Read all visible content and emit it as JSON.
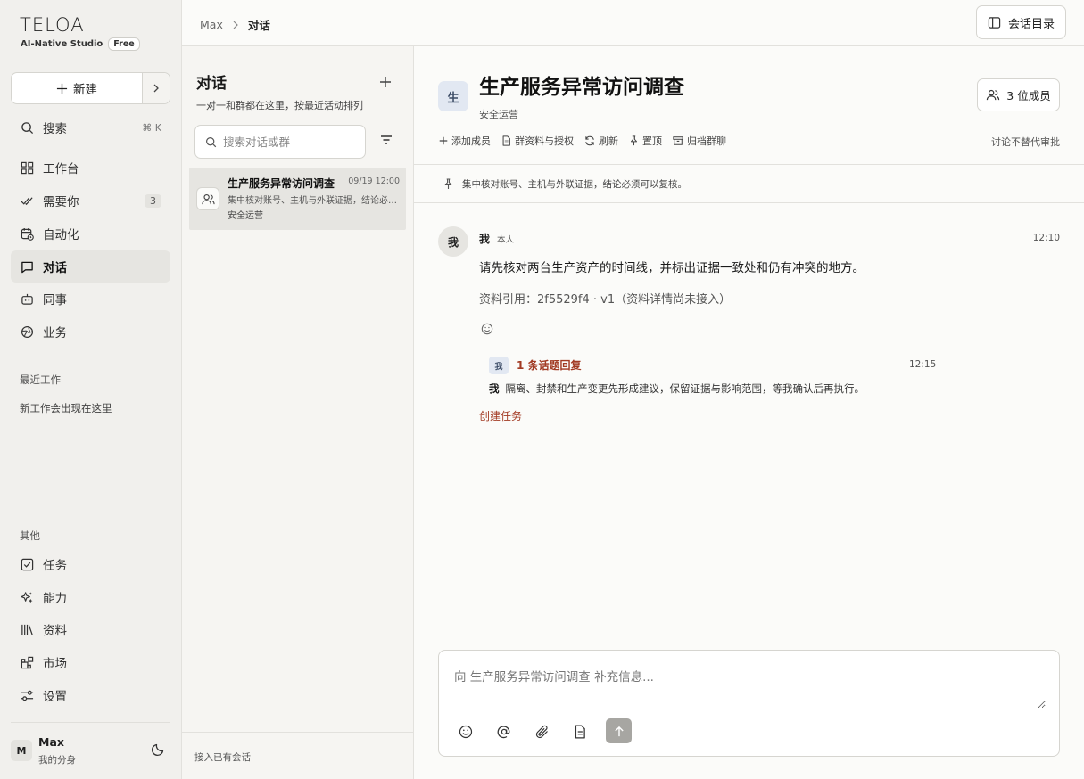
{
  "app": {
    "logo": "TELOA",
    "tagline": "AI-Native Studio",
    "plan_badge": "Free"
  },
  "sidebar": {
    "new_label": "新建",
    "search_label": "搜索",
    "search_shortcut": "⌘ K",
    "items": [
      {
        "label": "工作台",
        "icon": "grid-icon"
      },
      {
        "label": "需要你",
        "icon": "double-check-icon",
        "count": "3"
      },
      {
        "label": "自动化",
        "icon": "calendar-clock-icon"
      },
      {
        "label": "对话",
        "icon": "chat-icon",
        "active": true
      },
      {
        "label": "同事",
        "icon": "bot-icon"
      },
      {
        "label": "业务",
        "icon": "globe-icon"
      }
    ],
    "recent_label": "最近工作",
    "recent_empty": "新工作会出现在这里",
    "other_label": "其他",
    "other_items": [
      {
        "label": "任务",
        "icon": "checkbox-icon"
      },
      {
        "label": "能力",
        "icon": "sparkles-icon"
      },
      {
        "label": "资料",
        "icon": "library-icon"
      },
      {
        "label": "市场",
        "icon": "blocks-icon"
      },
      {
        "label": "设置",
        "icon": "sliders-icon"
      }
    ],
    "user": {
      "avatar": "M",
      "name": "Max",
      "subtitle": "我的分身"
    }
  },
  "topbar": {
    "breadcrumb": [
      "Max",
      "对话"
    ],
    "directory_label": "会话目录"
  },
  "conversations": {
    "title": "对话",
    "subtitle": "一对一和群都在这里，按最近活动排列",
    "search_placeholder": "搜索对话或群",
    "items": [
      {
        "name": "生产服务异常访问调查",
        "time": "09/19 12:00",
        "preview": "集中核对账号、主机与外联证据，结论必须可以复核。",
        "group": "安全运营"
      }
    ],
    "footer": "接入已有会话"
  },
  "chat": {
    "avatar": "生",
    "title": "生产服务异常访问调查",
    "subtitle": "安全运营",
    "members_label": "3 位成员",
    "actions": [
      {
        "label": "添加成员",
        "icon": "plus-icon"
      },
      {
        "label": "群资料与授权",
        "icon": "document-icon"
      },
      {
        "label": "刷新",
        "icon": "refresh-icon"
      },
      {
        "label": "置顶",
        "icon": "pin-icon"
      },
      {
        "label": "归档群聊",
        "icon": "archive-icon"
      }
    ],
    "action_note": "讨论不替代审批",
    "pinned": "集中核对账号、主机与外联证据，结论必须可以复核。",
    "message": {
      "avatar": "我",
      "author": "我",
      "self_tag": "本人",
      "time": "12:10",
      "text": "请先核对两台生产资产的时间线，并标出证据一致处和仍有冲突的地方。",
      "reference": "资料引用：2f5529f4 · v1（资料详情尚未接入）"
    },
    "thread": {
      "avatar": "我",
      "count_label": "1 条话题回复",
      "time": "12:15",
      "author": "我",
      "text": "隔离、封禁和生产变更先形成建议，保留证据与影响范围，等我确认后再执行。"
    },
    "create_task": "创建任务",
    "composer_placeholder": "向 生产服务异常访问调查 补充信息..."
  }
}
